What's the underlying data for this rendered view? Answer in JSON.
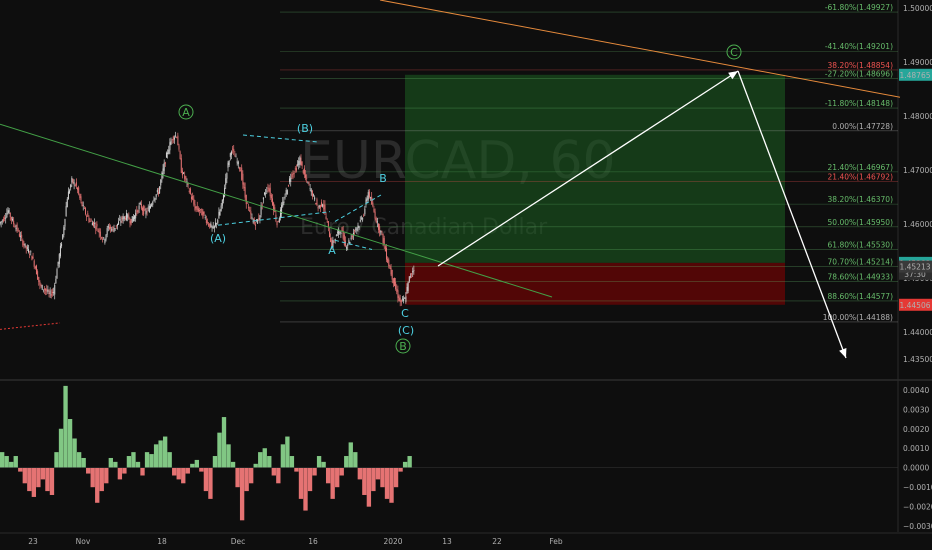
{
  "chart_data": [
    {
      "type": "line",
      "title": "EURCAD, 60",
      "subtitle": "Euro / Canadian Dollar",
      "instrument": "EURCAD",
      "timeframe": "60",
      "price_axis": {
        "ticks": [
          "1.50000",
          "1.49000",
          "1.48000",
          "1.47000",
          "1.46000",
          "1.45000",
          "1.44000",
          "1.43500"
        ],
        "ylim": [
          1.4315,
          1.5015
        ],
        "labels": [
          {
            "value": 1.48765,
            "text": "1.48765",
            "color": "#26a69a"
          },
          {
            "value": 1.45282,
            "text": "1.45282",
            "color": "#26a69a"
          },
          {
            "value": 1.4508,
            "text": "37:30",
            "color": "#2e2e2e"
          },
          {
            "value": 1.45213,
            "text": "1.45213",
            "color": "#3a3a3a"
          },
          {
            "value": 1.44506,
            "text": "1.44506",
            "color": "#e53935"
          }
        ]
      },
      "time_axis": {
        "ticks": [
          "23",
          "Nov",
          "18",
          "Dec",
          "16",
          "2020",
          "13",
          "22",
          "Feb"
        ]
      },
      "fib_levels": [
        {
          "text": "-61.80%(1.49927)",
          "value": 1.49927,
          "color": "#66bb6a"
        },
        {
          "text": "-41.40%(1.49201)",
          "value": 1.49201,
          "color": "#66bb6a"
        },
        {
          "text": "38.20%(1.48854)",
          "value": 1.48854,
          "color": "#ef5350"
        },
        {
          "text": "-27.20%(1.48696)",
          "value": 1.48696,
          "color": "#66bb6a"
        },
        {
          "text": "-11.80%(1.48148)",
          "value": 1.48148,
          "color": "#66bb6a"
        },
        {
          "text": "0.00%(1.47728)",
          "value": 1.47728,
          "color": "#b0b0b0"
        },
        {
          "text": "21.40%(1.46967)",
          "value": 1.46967,
          "color": "#66bb6a"
        },
        {
          "text": "21.40%(1.46792)",
          "value": 1.46792,
          "color": "#ef5350"
        },
        {
          "text": "38.20%(1.46370)",
          "value": 1.4637,
          "color": "#66bb6a"
        },
        {
          "text": "50.00%(1.45950)",
          "value": 1.4595,
          "color": "#66bb6a"
        },
        {
          "text": "61.80%(1.45530)",
          "value": 1.4553,
          "color": "#66bb6a"
        },
        {
          "text": "70.70%(1.45214)",
          "value": 1.45214,
          "color": "#66bb6a"
        },
        {
          "text": "78.60%(1.44933)",
          "value": 1.44933,
          "color": "#66bb6a"
        },
        {
          "text": "88.60%(1.44577)",
          "value": 1.44577,
          "color": "#66bb6a"
        },
        {
          "text": "100.00%(1.44188)",
          "value": 1.44188,
          "color": "#b0b0b0"
        }
      ],
      "wave_labels": [
        {
          "text": "A",
          "circled": true,
          "color": "#4caf50"
        },
        {
          "text": "(B)",
          "circled": false,
          "color": "#4dd0e1"
        },
        {
          "text": "(A)",
          "circled": false,
          "color": "#4dd0e1"
        },
        {
          "text": "B",
          "circled": false,
          "color": "#4dd0e1"
        },
        {
          "text": "A",
          "circled": false,
          "color": "#4dd0e1"
        },
        {
          "text": "C",
          "circled": false,
          "color": "#4dd0e1"
        },
        {
          "text": "(C)",
          "circled": false,
          "color": "#4dd0e1"
        },
        {
          "text": "B",
          "circled": true,
          "color": "#4caf50"
        },
        {
          "text": "C",
          "circled": true,
          "color": "#4caf50"
        }
      ],
      "position_tool": {
        "target": 1.48765,
        "entry": 1.45282,
        "stop": 1.44506
      },
      "price_series": [
        1.46,
        1.461,
        1.4625,
        1.4605,
        1.459,
        1.457,
        1.4555,
        1.4545,
        1.452,
        1.4485,
        1.448,
        1.447,
        1.4475,
        1.453,
        1.458,
        1.465,
        1.468,
        1.467,
        1.464,
        1.462,
        1.4605,
        1.46,
        1.4585,
        1.457,
        1.4595,
        1.459,
        1.46,
        1.461,
        1.4615,
        1.4605,
        1.462,
        1.4635,
        1.462,
        1.463,
        1.465,
        1.466,
        1.47,
        1.4735,
        1.476,
        1.4765,
        1.47,
        1.468,
        1.4655,
        1.463,
        1.4625,
        1.4615,
        1.46,
        1.459,
        1.461,
        1.464,
        1.47,
        1.474,
        1.472,
        1.47,
        1.465,
        1.462,
        1.46,
        1.461,
        1.465,
        1.467,
        1.464,
        1.46,
        1.463,
        1.466,
        1.469,
        1.47,
        1.472,
        1.469,
        1.467,
        1.465,
        1.463,
        1.464,
        1.46,
        1.456,
        1.458,
        1.459,
        1.456,
        1.457,
        1.459,
        1.46,
        1.462,
        1.466,
        1.463,
        1.46,
        1.458,
        1.454,
        1.451,
        1.448,
        1.4455,
        1.446,
        1.45,
        1.452
      ],
      "oscillator": {
        "ticks": [
          "0.0040",
          "0.0030",
          "0.0020",
          "0.0010",
          "0.0000",
          "−0.0010",
          "−0.0020",
          "−0.0030"
        ],
        "ylim": [
          -0.0033,
          0.0044
        ],
        "values": [
          0.0008,
          0.0006,
          0.0003,
          0.0006,
          -0.0002,
          -0.0008,
          -0.0012,
          -0.0015,
          -0.001,
          -0.0006,
          -0.0012,
          -0.0014,
          0.0008,
          0.002,
          0.0042,
          0.0025,
          0.0015,
          0.0008,
          0.0005,
          -0.0003,
          -0.001,
          -0.0018,
          -0.0012,
          -0.0008,
          0.0005,
          0.0003,
          -0.0006,
          -0.0003,
          0.0006,
          0.0008,
          0.0003,
          -0.0004,
          0.0008,
          0.0007,
          0.0012,
          0.0014,
          0.0016,
          0.0008,
          -0.0004,
          -0.0006,
          -0.0008,
          -0.0003,
          0.0002,
          0.0004,
          -0.0002,
          -0.0012,
          -0.0016,
          0.0006,
          0.0018,
          0.0026,
          0.0012,
          0.0003,
          -0.001,
          -0.0027,
          -0.0012,
          -0.0008,
          0.0002,
          0.0008,
          0.001,
          0.0006,
          -0.0004,
          -0.0008,
          0.0012,
          0.0016,
          0.0006,
          -0.0002,
          -0.0016,
          -0.0022,
          -0.0012,
          -0.0004,
          0.0006,
          0.0003,
          -0.0008,
          -0.0016,
          -0.001,
          -0.0004,
          0.0006,
          0.0013,
          0.0008,
          -0.0006,
          -0.0014,
          -0.002,
          -0.0012,
          -0.0006,
          -0.001,
          -0.0016,
          -0.0018,
          -0.001,
          -0.0002,
          0.0003,
          0.0006
        ]
      }
    }
  ]
}
